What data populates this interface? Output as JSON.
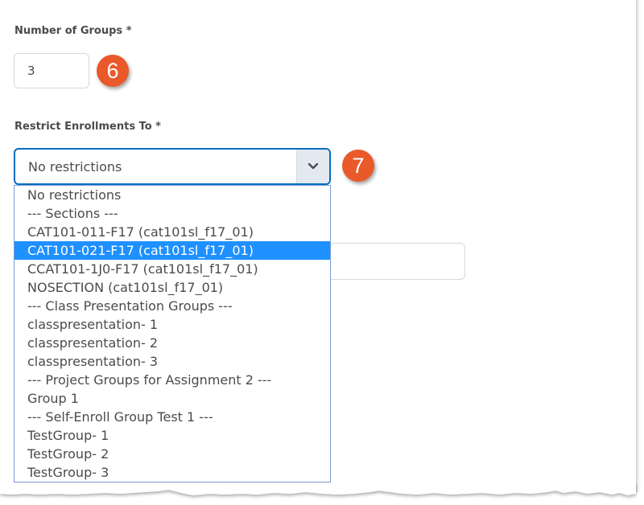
{
  "form": {
    "number_of_groups": {
      "label": "Number of Groups *",
      "value": "3",
      "callout": "6"
    },
    "restrict_enrollments": {
      "label": "Restrict Enrollments To *",
      "selected_value": "No restrictions",
      "callout": "7",
      "highlighted_option": "CAT101-021-F17 (cat101sl_f17_01)",
      "options": [
        "No restrictions",
        "--- Sections ---",
        "CAT101-011-F17 (cat101sl_f17_01)",
        "CAT101-021-F17 (cat101sl_f17_01)",
        "CCAT101-1J0-F17 (cat101sl_f17_01)",
        "NOSECTION (cat101sl_f17_01)",
        "--- Class Presentation Groups ---",
        "classpresentation- 1",
        "classpresentation- 2",
        "classpresentation- 3",
        "--- Project Groups for Assignment 2 ---",
        "Group 1",
        "--- Self-Enroll Group Test 1 ---",
        "TestGroup- 1",
        "TestGroup- 2",
        "TestGroup- 3"
      ]
    }
  },
  "colors": {
    "callout": "#e9592a",
    "focus_border": "#006fbf",
    "highlight": "#1e90ff"
  }
}
